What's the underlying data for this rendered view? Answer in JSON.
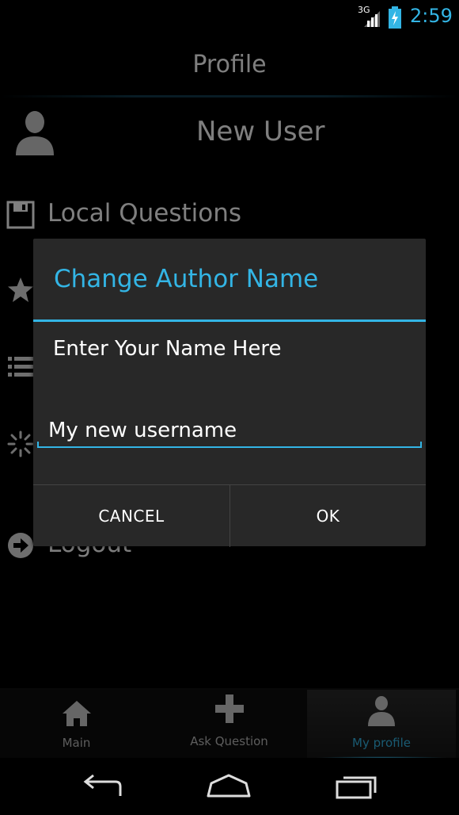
{
  "status_bar": {
    "network": "3G",
    "time": "2:59"
  },
  "action_bar": {
    "title": "Profile"
  },
  "profile": {
    "user_name": "New User",
    "menu_items": [
      {
        "label": "Local Questions",
        "icon": "save-icon"
      },
      {
        "label": "",
        "icon": "star-icon"
      },
      {
        "label": "",
        "icon": "list-icon"
      },
      {
        "label": "",
        "icon": "loading-icon"
      },
      {
        "label": "Logout",
        "icon": "logout-arrow-icon"
      }
    ]
  },
  "dialog": {
    "title": "Change Author Name",
    "message": "Enter Your Name Here",
    "input_value": "My new username",
    "cancel_label": "CANCEL",
    "ok_label": "OK",
    "accent_color": "#33b5e5"
  },
  "tabs": [
    {
      "label": "Main",
      "icon": "home-icon"
    },
    {
      "label": "Ask Question",
      "icon": "plus-icon"
    },
    {
      "label": "My profile",
      "icon": "person-icon",
      "selected": true
    }
  ],
  "nav_bar": {
    "buttons": [
      "back-icon",
      "home-nav-icon",
      "recents-icon"
    ]
  }
}
